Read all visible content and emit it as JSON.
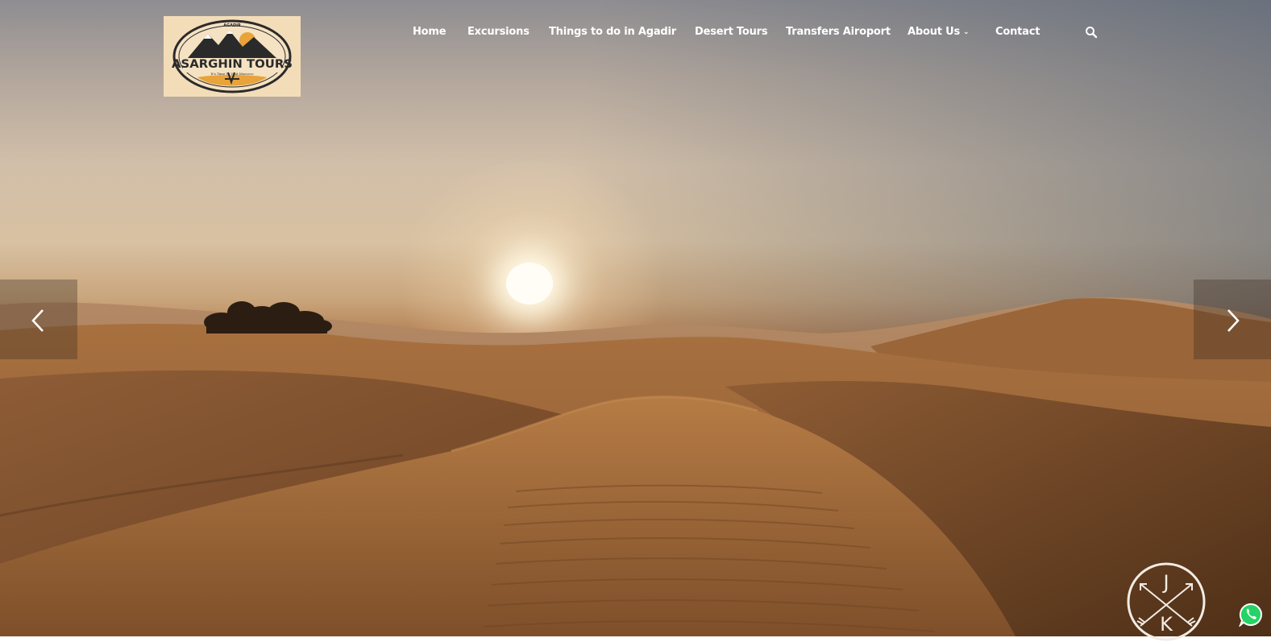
{
  "brand": {
    "name": "ASARGHIN TOURS",
    "top_text": "AGADIR",
    "tagline": "It's Time To Visit Morocco"
  },
  "nav": {
    "items": [
      {
        "label": "Home"
      },
      {
        "label": "Excursions"
      },
      {
        "label": "Things to do in Agadir"
      },
      {
        "label": "Desert Tours"
      },
      {
        "label": "Transfers Airoport"
      },
      {
        "label": "About Us",
        "has_dropdown": true
      },
      {
        "label": "Contact"
      }
    ],
    "search_icon": "search-icon"
  },
  "slider": {
    "prev_icon": "chevron-left-icon",
    "next_icon": "chevron-right-icon"
  },
  "watermark": {
    "text_top": "J",
    "text_bottom": "K"
  },
  "whatsapp": {
    "icon": "whatsapp-icon",
    "color": "#25d366"
  },
  "colors": {
    "nav_text": "#ffffff",
    "logo_bg": "#f3dcb8"
  }
}
